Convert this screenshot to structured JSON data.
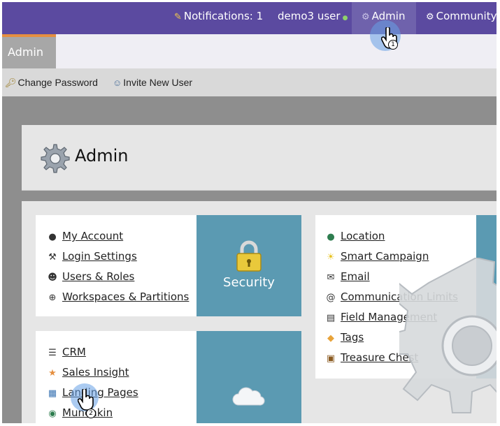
{
  "topnav": {
    "notifications": "Notifications: 1",
    "user": "demo3 user",
    "admin": "Admin",
    "community": "Community"
  },
  "subheader": {
    "tab": "Admin"
  },
  "toolbar": {
    "change_password": "Change Password",
    "invite_user": "Invite New User"
  },
  "title": "Admin",
  "security_card": {
    "items": [
      {
        "label": "My Account",
        "icon": "user-icon"
      },
      {
        "label": "Login Settings",
        "icon": "wrench-icon"
      },
      {
        "label": "Users & Roles",
        "icon": "users-icon"
      },
      {
        "label": "Workspaces & Partitions",
        "icon": "globe-icon"
      }
    ],
    "tile_label": "Security"
  },
  "integration_card": {
    "items": [
      {
        "label": "CRM",
        "icon": "database-icon"
      },
      {
        "label": "Sales Insight",
        "icon": "star-icon"
      },
      {
        "label": "Landing Pages",
        "icon": "page-icon"
      },
      {
        "label": "Munchkin",
        "icon": "munchkin-icon"
      }
    ],
    "tile_icon": "cloud-icon"
  },
  "marketing_card": {
    "items": [
      {
        "label": "Location",
        "icon": "location-globe-icon"
      },
      {
        "label": "Smart Campaign",
        "icon": "lightbulb-icon"
      },
      {
        "label": "Email",
        "icon": "email-icon"
      },
      {
        "label": "Communication Limits",
        "icon": "at-icon"
      },
      {
        "label": "Field Management",
        "icon": "field-icon"
      },
      {
        "label": "Tags",
        "icon": "tag-icon"
      },
      {
        "label": "Treasure Chest",
        "icon": "chest-icon"
      }
    ]
  },
  "annotations": {
    "step1": "1",
    "step2": "2"
  },
  "colors": {
    "nav": "#5b4aa0",
    "tile": "#5b9ab2",
    "tab_accent": "#e58f40"
  }
}
